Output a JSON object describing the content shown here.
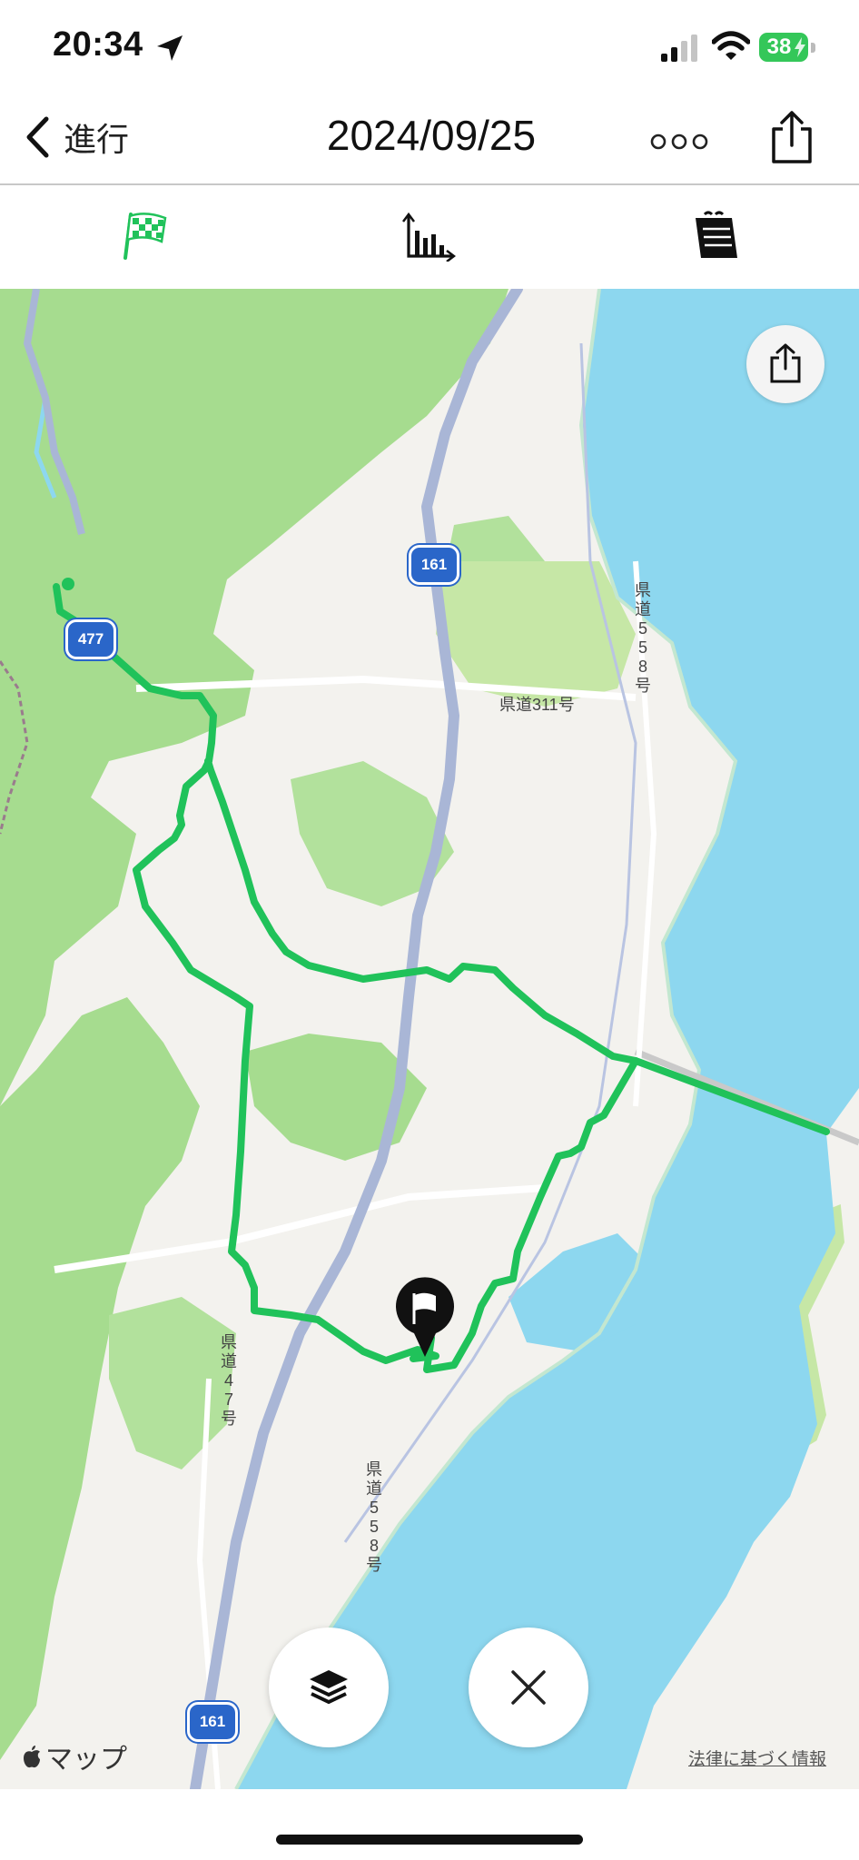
{
  "status_bar": {
    "time": "20:34",
    "battery_percent": "38",
    "icons": [
      "location-arrow-icon",
      "cellular-signal-icon",
      "wifi-icon",
      "battery-charging-icon"
    ]
  },
  "nav": {
    "back_label": "進行",
    "title": "2024/09/25",
    "more_icon": "ellipsis-icon",
    "share_icon": "share-icon"
  },
  "tabs": [
    {
      "icon": "checkered-flag-icon",
      "active": true
    },
    {
      "icon": "bar-chart-icon",
      "active": false
    },
    {
      "icon": "notes-icon",
      "active": false
    }
  ],
  "map": {
    "road_labels": {
      "route311": "県道311号",
      "route558_north": "県道558号",
      "route47": "県道47号",
      "route558_south": "県道558号"
    },
    "shields": {
      "r161_north": "161",
      "r477": "477",
      "r161_south": "161"
    },
    "attribution": "マップ",
    "legal_link": "法律に基づく情報",
    "colors": {
      "route": "#20c25a",
      "water": "#8dd7ef",
      "forest": "#a6dc8f",
      "highway": "#a9b6d6",
      "shield": "#2a66c9"
    },
    "buttons": [
      "layers-icon",
      "close-icon"
    ]
  }
}
